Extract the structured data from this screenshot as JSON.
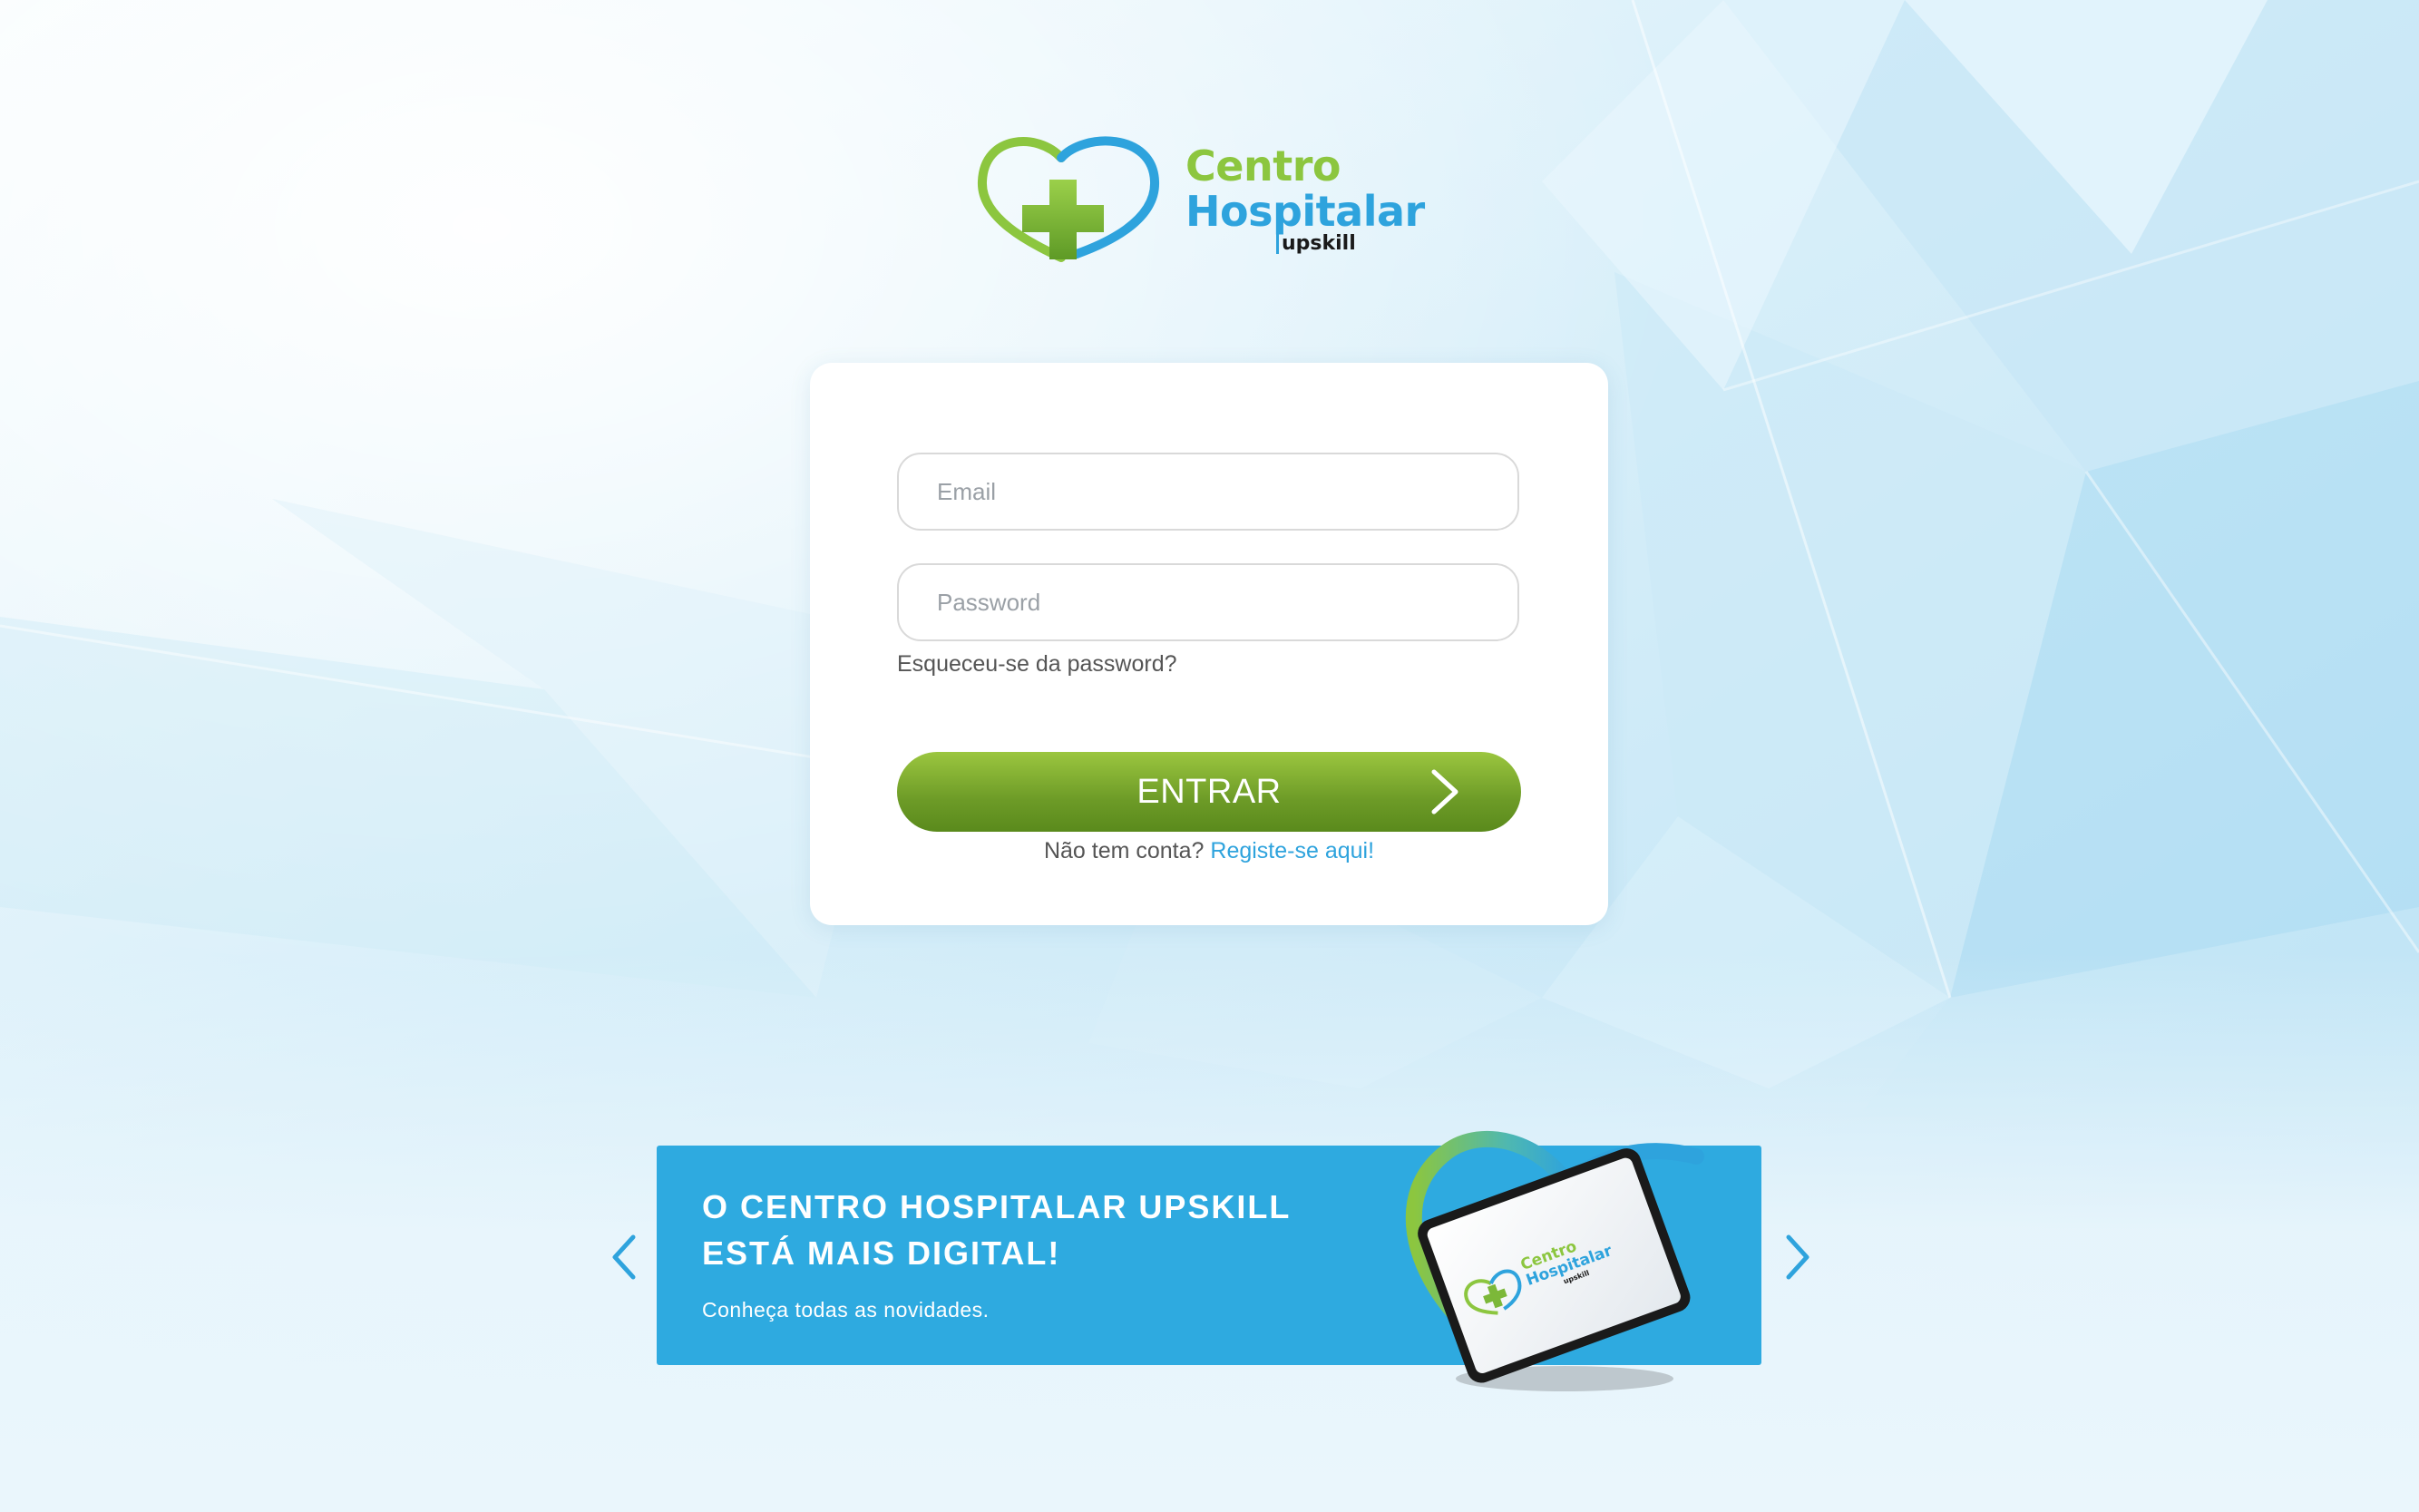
{
  "logo": {
    "line1": "Centro",
    "line2": "Hospitalar",
    "line3": "upskill"
  },
  "login": {
    "email_placeholder": "Email",
    "password_placeholder": "Password",
    "forgot_label": "Esqueceu-se da password?",
    "enter_label": "ENTRAR",
    "no_account_text": "Não tem conta?",
    "register_link": "Registe-se aqui!"
  },
  "banner": {
    "title_line1": "O CENTRO HOSPITALAR UPSKILL",
    "title_line2": "ESTÁ MAIS DIGITAL!",
    "subtitle": "Conheça todas as novidades.",
    "tablet_logo_line1": "Centro",
    "tablet_logo_line2": "Hospitalar",
    "tablet_logo_line3": "upskill"
  },
  "icons": {
    "logo": "heart-cross-logo-icon",
    "enter": "chevron-right-icon",
    "prev": "chevron-left-icon",
    "next": "chevron-right-icon"
  },
  "colors": {
    "brand_green": "#8cc63f",
    "brand_blue": "#2ea3dd",
    "button_green": "#6d9b27",
    "banner_blue": "#2eaae0",
    "background": "#e8f5fb"
  }
}
